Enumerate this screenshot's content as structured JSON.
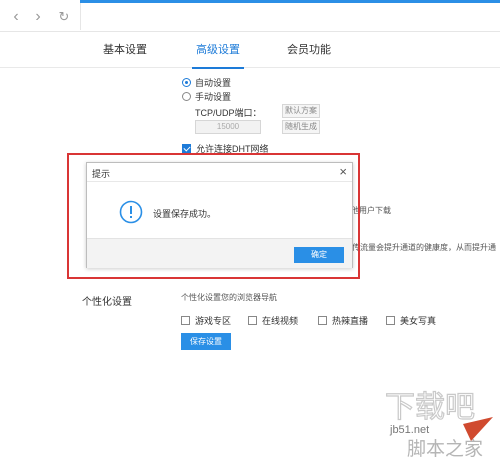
{
  "browser": {
    "back_glyph": "‹",
    "forward_glyph": "›",
    "reload_glyph": "↻"
  },
  "tabs": [
    {
      "label": "基本设置"
    },
    {
      "label": "高级设置"
    },
    {
      "label": "会员功能"
    }
  ],
  "port_section": {
    "auto_label": "自动设置",
    "manual_label": "手动设置",
    "port_label": "TCP/UDP端口：",
    "default_button": "默认方案",
    "port_value": "15000",
    "random_button": "随机生成",
    "dht_label": "允许连接DHT网络"
  },
  "background_text": {
    "partial_download": "他用户下载",
    "partial_health": "传流量会提升通道的健康度，从而提升通"
  },
  "personalize": {
    "heading": "个性化设置",
    "desc": "个性化设置您的浏览器导航",
    "options": [
      {
        "label": "游戏专区"
      },
      {
        "label": "在线视频"
      },
      {
        "label": "热辣直播"
      },
      {
        "label": "美女写真"
      }
    ],
    "save_button": "保存设置"
  },
  "dialog": {
    "title": "提示",
    "close_glyph": "×",
    "message": "设置保存成功。",
    "ok_button": "确定"
  },
  "watermark": {
    "logo_text": "下载吧",
    "domain": "jb51.net",
    "site_name": "脚本之家"
  },
  "colors": {
    "accent": "#1d7bd8",
    "button_blue": "#2a8fe6",
    "highlight_frame": "#d93535"
  }
}
